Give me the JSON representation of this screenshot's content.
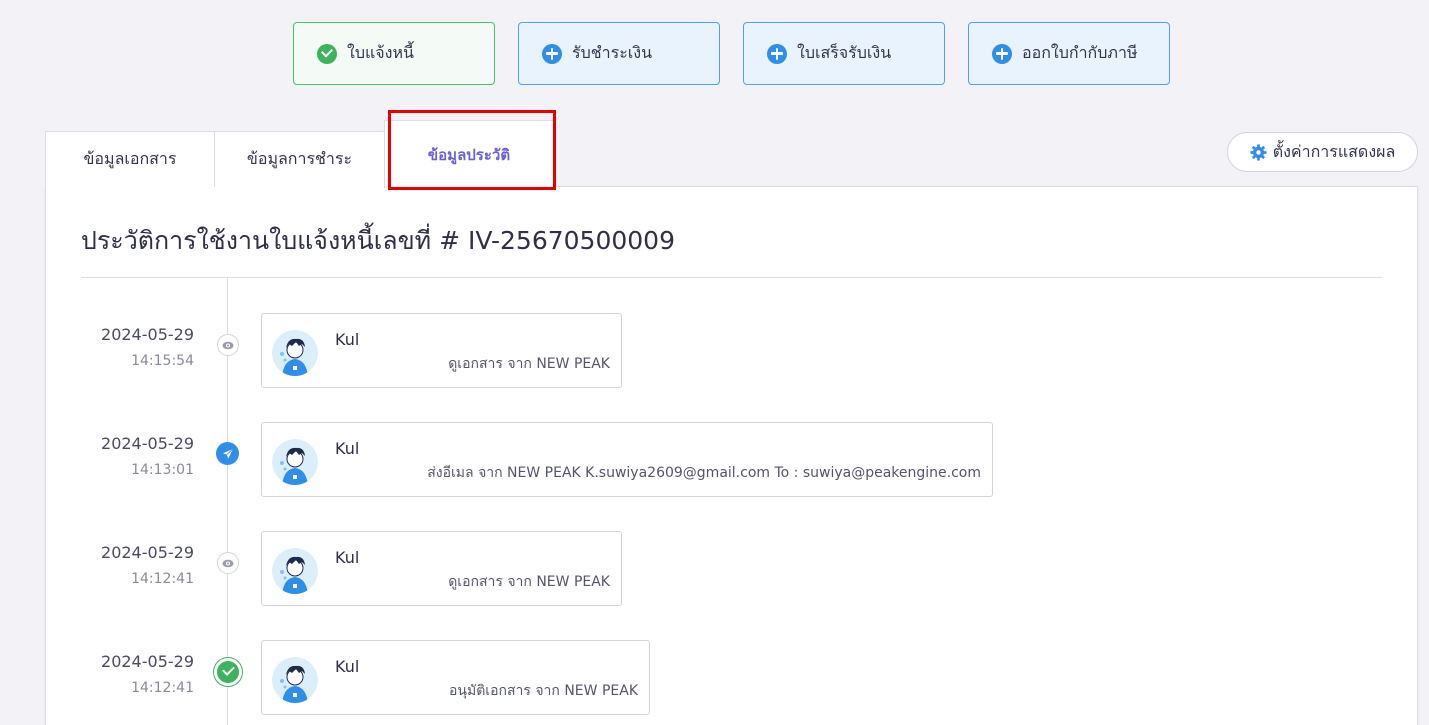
{
  "steps": [
    {
      "label": "ใบแจ้งหนี้",
      "state": "done",
      "icon": "check-circle-icon"
    },
    {
      "label": "รับชำระเงิน",
      "state": "todo",
      "icon": "plus-circle-icon"
    },
    {
      "label": "ใบเสร็จรับเงิน",
      "state": "todo",
      "icon": "plus-circle-icon"
    },
    {
      "label": "ออกใบกำกับภาษี",
      "state": "todo",
      "icon": "plus-circle-icon"
    }
  ],
  "tabs": [
    {
      "label": "ข้อมูลเอกสาร",
      "active": false
    },
    {
      "label": "ข้อมูลการชำระ",
      "active": false
    },
    {
      "label": "ข้อมูลประวัติ",
      "active": true
    }
  ],
  "settings": {
    "label": "ตั้งค่าการแสดงผล",
    "icon": "gear-icon"
  },
  "history": {
    "title": "ประวัติการใช้งานใบแจ้งหนี้เลขที่ # IV-25670500009",
    "entries": [
      {
        "date": "2024-05-29",
        "time": "14:15:54",
        "user": "Kul",
        "action": "ดูเอกสาร จาก NEW PEAK",
        "icon": "eye-icon"
      },
      {
        "date": "2024-05-29",
        "time": "14:13:01",
        "user": "Kul",
        "action": "ส่งอีเมล จาก NEW PEAK K.suwiya2609@gmail.com To : suwiya@peakengine.com",
        "icon": "send-icon"
      },
      {
        "date": "2024-05-29",
        "time": "14:12:41",
        "user": "Kul",
        "action": "ดูเอกสาร จาก NEW PEAK",
        "icon": "eye-icon"
      },
      {
        "date": "2024-05-29",
        "time": "14:12:41",
        "user": "Kul",
        "action": "อนุมัติเอกสาร จาก NEW PEAK",
        "icon": "approve-icon"
      }
    ]
  },
  "colors": {
    "accent": "#6a5fd6",
    "success": "#3cb35c",
    "primary": "#2f8ee8",
    "highlight": "#e60000"
  }
}
